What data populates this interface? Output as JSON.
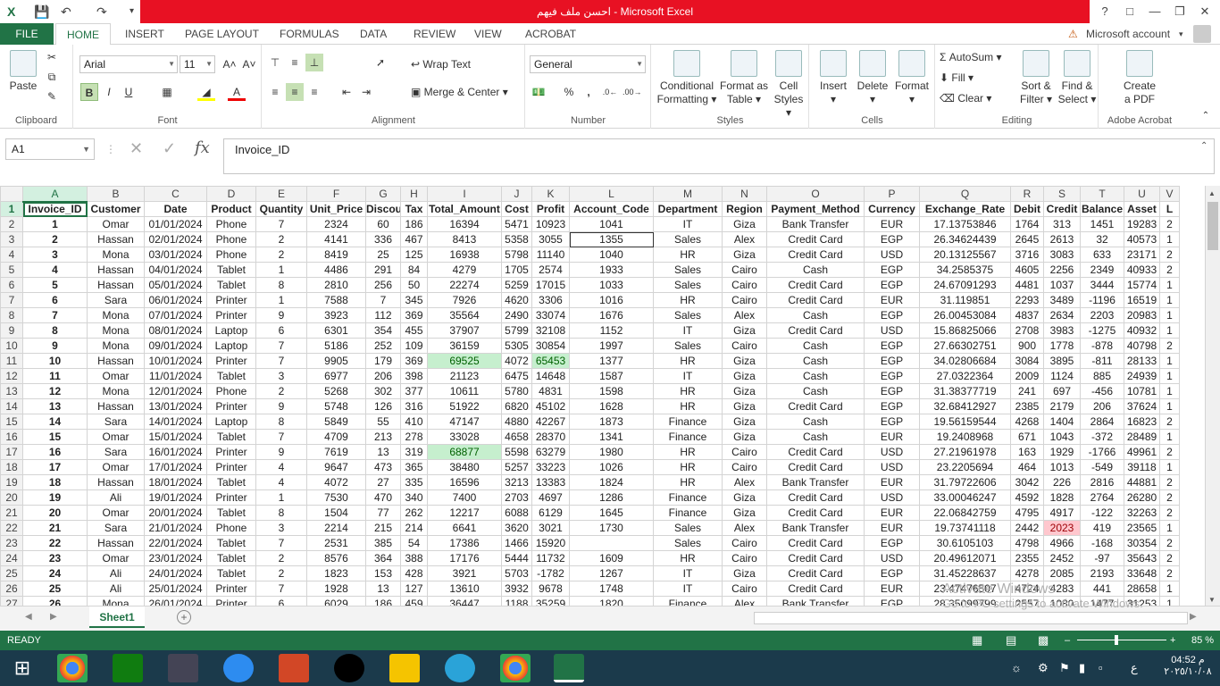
{
  "title_bar": {
    "file_title": "احسن ملف فيهم",
    "app": "Microsoft Excel",
    "sep": " - "
  },
  "menu": {
    "file": "FILE",
    "tabs": [
      "HOME",
      "INSERT",
      "PAGE LAYOUT",
      "FORMULAS",
      "DATA",
      "REVIEW",
      "VIEW",
      "ACROBAT"
    ],
    "account": "Microsoft account"
  },
  "ribbon": {
    "clipboard": {
      "label": "Clipboard",
      "paste": "Paste"
    },
    "font": {
      "label": "Font",
      "name": "Arial",
      "size": "11"
    },
    "alignment": {
      "label": "Alignment",
      "wrap": "Wrap Text",
      "merge": "Merge & Center"
    },
    "number": {
      "label": "Number",
      "format": "General"
    },
    "styles": {
      "label": "Styles",
      "conditional": "Conditional",
      "conditional2": "Formatting",
      "format_as": "Format as",
      "format_as2": "Table",
      "cell": "Cell",
      "cell2": "Styles"
    },
    "cells": {
      "label": "Cells",
      "insert": "Insert",
      "delete": "Delete",
      "format": "Format"
    },
    "editing": {
      "label": "Editing",
      "autosum": "AutoSum",
      "fill": "Fill",
      "clear": "Clear",
      "sort": "Sort &",
      "sort2": "Filter",
      "find": "Find &",
      "find2": "Select"
    },
    "acrobat": {
      "label": "Adobe Acrobat",
      "create": "Create",
      "create2": "a PDF"
    }
  },
  "formula_bar": {
    "cell_ref": "A1",
    "fx": "fx",
    "content": "Invoice_ID"
  },
  "columns": [
    "A",
    "B",
    "C",
    "D",
    "E",
    "F",
    "G",
    "H",
    "I",
    "J",
    "K",
    "L",
    "M",
    "N",
    "O",
    "P",
    "Q",
    "R",
    "S",
    "T",
    "U",
    "V"
  ],
  "header_row": [
    "Invoice_ID",
    "Customer",
    "Date",
    "Product",
    "Quantity",
    "Unit_Price",
    "Discount",
    "Tax",
    "Total_Amount",
    "Cost",
    "Profit",
    "Account_Code",
    "Department",
    "Region",
    "Payment_Method",
    "Currency",
    "Exchange_Rate",
    "Debit",
    "Credit",
    "Balance",
    "Asset",
    "L"
  ],
  "rows": [
    [
      "1",
      "Omar",
      "01/01/2024",
      "Phone",
      "7",
      "2324",
      "60",
      "186",
      "16394",
      "5471",
      "10923",
      "1041",
      "IT",
      "Giza",
      "Bank Transfer",
      "EUR",
      "17.13753846",
      "1764",
      "313",
      "1451",
      "19283",
      "2"
    ],
    [
      "2",
      "Hassan",
      "02/01/2024",
      "Phone",
      "2",
      "4141",
      "336",
      "467",
      "8413",
      "5358",
      "3055",
      "1355",
      "Sales",
      "Alex",
      "Credit Card",
      "EGP",
      "26.34624439",
      "2645",
      "2613",
      "32",
      "40573",
      "1"
    ],
    [
      "3",
      "Mona",
      "03/01/2024",
      "Phone",
      "2",
      "8419",
      "25",
      "125",
      "16938",
      "5798",
      "11140",
      "1040",
      "HR",
      "Giza",
      "Credit Card",
      "USD",
      "20.13125567",
      "3716",
      "3083",
      "633",
      "23171",
      "2"
    ],
    [
      "4",
      "Hassan",
      "04/01/2024",
      "Tablet",
      "1",
      "4486",
      "291",
      "84",
      "4279",
      "1705",
      "2574",
      "1933",
      "Sales",
      "Cairo",
      "Cash",
      "EGP",
      "34.2585375",
      "4605",
      "2256",
      "2349",
      "40933",
      "2"
    ],
    [
      "5",
      "Hassan",
      "05/01/2024",
      "Tablet",
      "8",
      "2810",
      "256",
      "50",
      "22274",
      "5259",
      "17015",
      "1033",
      "Sales",
      "Cairo",
      "Credit Card",
      "EGP",
      "24.67091293",
      "4481",
      "1037",
      "3444",
      "15774",
      "1"
    ],
    [
      "6",
      "Sara",
      "06/01/2024",
      "Printer",
      "1",
      "7588",
      "7",
      "345",
      "7926",
      "4620",
      "3306",
      "1016",
      "HR",
      "Cairo",
      "Credit Card",
      "EUR",
      "31.119851",
      "2293",
      "3489",
      "-1196",
      "16519",
      "1"
    ],
    [
      "7",
      "Mona",
      "07/01/2024",
      "Printer",
      "9",
      "3923",
      "112",
      "369",
      "35564",
      "2490",
      "33074",
      "1676",
      "Sales",
      "Alex",
      "Cash",
      "EGP",
      "26.00453084",
      "4837",
      "2634",
      "2203",
      "20983",
      "1"
    ],
    [
      "8",
      "Mona",
      "08/01/2024",
      "Laptop",
      "6",
      "6301",
      "354",
      "455",
      "37907",
      "5799",
      "32108",
      "1152",
      "IT",
      "Giza",
      "Credit Card",
      "USD",
      "15.86825066",
      "2708",
      "3983",
      "-1275",
      "40932",
      "1"
    ],
    [
      "9",
      "Mona",
      "09/01/2024",
      "Laptop",
      "7",
      "5186",
      "252",
      "109",
      "36159",
      "5305",
      "30854",
      "1997",
      "Sales",
      "Cairo",
      "Cash",
      "EGP",
      "27.66302751",
      "900",
      "1778",
      "-878",
      "40798",
      "2"
    ],
    [
      "10",
      "Hassan",
      "10/01/2024",
      "Printer",
      "7",
      "9905",
      "179",
      "369",
      "69525",
      "4072",
      "65453",
      "1377",
      "HR",
      "Giza",
      "Cash",
      "EGP",
      "34.02806684",
      "3084",
      "3895",
      "-811",
      "28133",
      "1"
    ],
    [
      "11",
      "Omar",
      "11/01/2024",
      "Tablet",
      "3",
      "6977",
      "206",
      "398",
      "21123",
      "6475",
      "14648",
      "1587",
      "IT",
      "Giza",
      "Cash",
      "EGP",
      "27.0322364",
      "2009",
      "1124",
      "885",
      "24939",
      "1"
    ],
    [
      "12",
      "Mona",
      "12/01/2024",
      "Phone",
      "2",
      "5268",
      "302",
      "377",
      "10611",
      "5780",
      "4831",
      "1598",
      "HR",
      "Giza",
      "Cash",
      "EGP",
      "31.38377719",
      "241",
      "697",
      "-456",
      "10781",
      "1"
    ],
    [
      "13",
      "Hassan",
      "13/01/2024",
      "Printer",
      "9",
      "5748",
      "126",
      "316",
      "51922",
      "6820",
      "45102",
      "1628",
      "HR",
      "Giza",
      "Credit Card",
      "EGP",
      "32.68412927",
      "2385",
      "2179",
      "206",
      "37624",
      "1"
    ],
    [
      "14",
      "Sara",
      "14/01/2024",
      "Laptop",
      "8",
      "5849",
      "55",
      "410",
      "47147",
      "4880",
      "42267",
      "1873",
      "Finance",
      "Giza",
      "Cash",
      "EGP",
      "19.56159544",
      "4268",
      "1404",
      "2864",
      "16823",
      "2"
    ],
    [
      "15",
      "Omar",
      "15/01/2024",
      "Tablet",
      "7",
      "4709",
      "213",
      "278",
      "33028",
      "4658",
      "28370",
      "1341",
      "Finance",
      "Giza",
      "Cash",
      "EUR",
      "19.2408968",
      "671",
      "1043",
      "-372",
      "28489",
      "1"
    ],
    [
      "16",
      "Sara",
      "16/01/2024",
      "Printer",
      "9",
      "7619",
      "13",
      "319",
      "68877",
      "5598",
      "63279",
      "1980",
      "HR",
      "Cairo",
      "Credit Card",
      "USD",
      "27.21961978",
      "163",
      "1929",
      "-1766",
      "49961",
      "2"
    ],
    [
      "17",
      "Omar",
      "17/01/2024",
      "Printer",
      "4",
      "9647",
      "473",
      "365",
      "38480",
      "5257",
      "33223",
      "1026",
      "HR",
      "Cairo",
      "Credit Card",
      "USD",
      "23.2205694",
      "464",
      "1013",
      "-549",
      "39118",
      "1"
    ],
    [
      "18",
      "Hassan",
      "18/01/2024",
      "Tablet",
      "4",
      "4072",
      "27",
      "335",
      "16596",
      "3213",
      "13383",
      "1824",
      "HR",
      "Alex",
      "Bank Transfer",
      "EUR",
      "31.79722606",
      "3042",
      "226",
      "2816",
      "44881",
      "2"
    ],
    [
      "19",
      "Ali",
      "19/01/2024",
      "Printer",
      "1",
      "7530",
      "470",
      "340",
      "7400",
      "2703",
      "4697",
      "1286",
      "Finance",
      "Giza",
      "Credit Card",
      "USD",
      "33.00046247",
      "4592",
      "1828",
      "2764",
      "26280",
      "2"
    ],
    [
      "20",
      "Omar",
      "20/01/2024",
      "Tablet",
      "8",
      "1504",
      "77",
      "262",
      "12217",
      "6088",
      "6129",
      "1645",
      "Finance",
      "Giza",
      "Credit Card",
      "EUR",
      "22.06842759",
      "4795",
      "4917",
      "-122",
      "32263",
      "2"
    ],
    [
      "21",
      "Sara",
      "21/01/2024",
      "Phone",
      "3",
      "2214",
      "215",
      "214",
      "6641",
      "3620",
      "3021",
      "1730",
      "Sales",
      "Alex",
      "Bank Transfer",
      "EUR",
      "19.73741118",
      "2442",
      "2023",
      "419",
      "23565",
      "1"
    ],
    [
      "22",
      "Hassan",
      "22/01/2024",
      "Tablet",
      "7",
      "2531",
      "385",
      "54",
      "17386",
      "1466",
      "15920",
      "",
      "Sales",
      "Cairo",
      "Credit Card",
      "EGP",
      "30.6105103",
      "4798",
      "4966",
      "-168",
      "30354",
      "2"
    ],
    [
      "23",
      "Omar",
      "23/01/2024",
      "Tablet",
      "2",
      "8576",
      "364",
      "388",
      "17176",
      "5444",
      "11732",
      "1609",
      "HR",
      "Cairo",
      "Credit Card",
      "USD",
      "20.49612071",
      "2355",
      "2452",
      "-97",
      "35643",
      "2"
    ],
    [
      "24",
      "Ali",
      "24/01/2024",
      "Tablet",
      "2",
      "1823",
      "153",
      "428",
      "3921",
      "5703",
      "-1782",
      "1267",
      "IT",
      "Giza",
      "Credit Card",
      "EGP",
      "31.45228637",
      "4278",
      "2085",
      "2193",
      "33648",
      "2"
    ],
    [
      "25",
      "Ali",
      "25/01/2024",
      "Printer",
      "7",
      "1928",
      "13",
      "127",
      "13610",
      "3932",
      "9678",
      "1748",
      "IT",
      "Cairo",
      "Credit Card",
      "EUR",
      "23.47476507",
      "4724",
      "4283",
      "441",
      "28658",
      "1"
    ],
    [
      "26",
      "Mona",
      "26/01/2024",
      "Printer",
      "6",
      "6029",
      "186",
      "459",
      "36447",
      "1188",
      "35259",
      "1820",
      "Finance",
      "Alex",
      "Bank Transfer",
      "EGP",
      "28.35099799",
      "2557",
      "1080",
      "1477",
      "31253",
      "1"
    ]
  ],
  "highlights": {
    "green_cells": [
      "I11",
      "K11",
      "I17"
    ],
    "pink_cells": [
      "S22"
    ]
  },
  "sheet_tab": "Sheet1",
  "status": {
    "ready": "READY",
    "zoom": "85 %"
  },
  "watermark": {
    "line1": "Activate Windows",
    "line2": "Go to PC settings to activate Windows."
  },
  "taskbar": {
    "time": "04:52 م",
    "date": "٢٠٢٥/١٠/٠٨",
    "lang": "ع"
  }
}
